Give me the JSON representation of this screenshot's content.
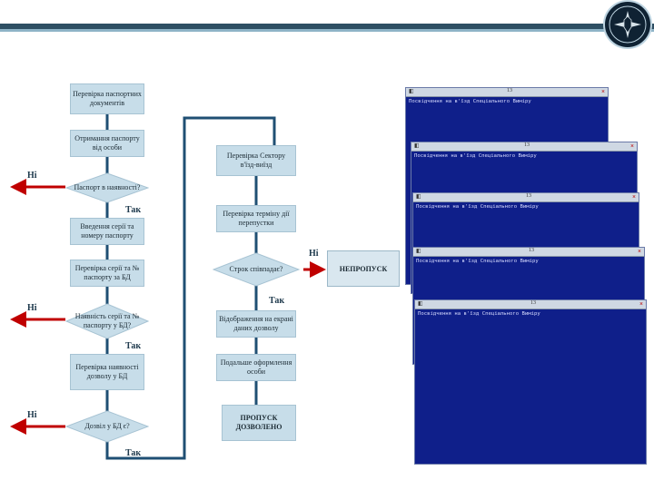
{
  "colors": {
    "box": "#c7dde9",
    "line": "#1f4f73",
    "arrow_red": "#c00000",
    "terminal_bg": "#0f1f8a"
  },
  "emblem": {
    "icon": "security-service-emblem-icon"
  },
  "flowchart": {
    "left": {
      "check_docs": "Перевірка паспортних документів",
      "get_passport": "Отримання паспорту від особи",
      "passport_present": "Паспорт в наявності?",
      "enter_series": "Введення серії та номеру паспорту",
      "check_series_db": "Перевірка серії та № паспорту за БД",
      "series_match": "Наявність серії та № паспорту у БД?",
      "check_permit": "Перевірка наявності дозволу у БД",
      "permit_present": "Дозвіл у БД є?"
    },
    "middle": {
      "check_sector": "Перевірка Сектору в'їзд-виїзд",
      "check_validity": "Перевірка терміну дії перепустки",
      "term_match": "Строк співпадає?",
      "display_data": "Відображення на екрані даних дозволу",
      "issue_permit": "Подальше оформлення особи",
      "pass_allowed": "ПРОПУСК ДОЗВОЛЕНО"
    },
    "labels": {
      "yes": "Так",
      "no": "Ні"
    },
    "denied": "НЕПРОПУСК"
  },
  "terminals": [
    {
      "title": "Посвідчення на в'їзд Спеціального Виміру",
      "num": "13"
    },
    {
      "title": "Посвідчення на в'їзд Спеціального Виміру",
      "num": "13"
    },
    {
      "title": "Посвідчення на в'їзд Спеціального Виміру",
      "num": "13"
    },
    {
      "title": "Посвідчення на в'їзд Спеціального Виміру",
      "num": "13"
    },
    {
      "title": "Посвідчення на в'їзд Спеціального Виміру",
      "num": "13"
    }
  ]
}
